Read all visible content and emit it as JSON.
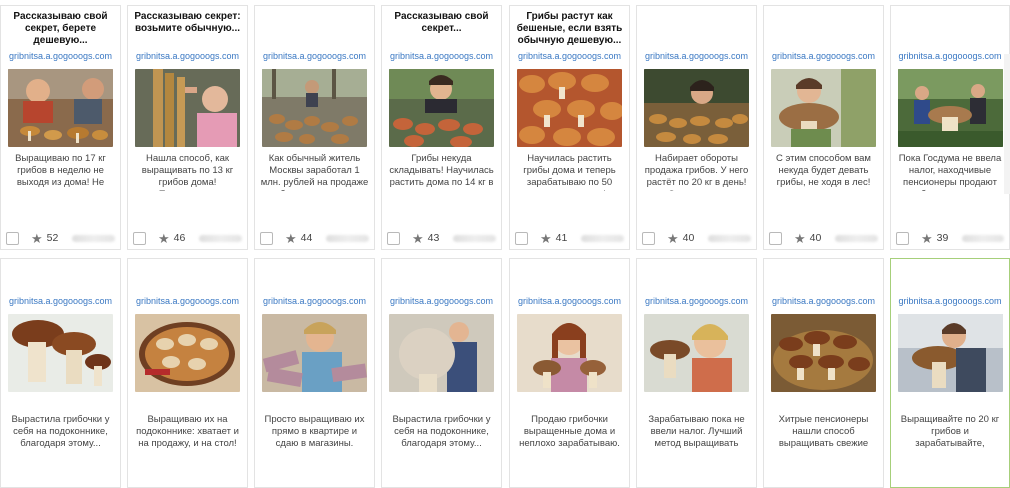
{
  "cards": [
    {
      "title": "Рассказываю свой секрет, берете дешевую...",
      "domain": "gribnitsa.a.gogooogs.com",
      "desc": "Выращиваю по 17 кг грибов в неделю не выходя из дома! Не знаем, куда девать",
      "rating": "52"
    },
    {
      "title": "Рассказываю секрет: возьмите обычную...",
      "domain": "gribnitsa.a.gogooogs.com",
      "desc": "Нашла способ, как выращивать по 13 кг грибов дома! Присоедится",
      "rating": "46"
    },
    {
      "title": "",
      "domain": "gribnitsa.a.gogooogs.com",
      "desc": "Как обычный житель Москвы заработал 1 млн. рублей на продаже грибов выращенных в",
      "rating": "44"
    },
    {
      "title": "Рассказываю свой секрет...",
      "domain": "gribnitsa.a.gogooogs.com",
      "desc": "Грибы некуда складывать! Научилась растить дома по 14 кг в неделю",
      "rating": "43"
    },
    {
      "title": "Грибы растут как бешеные, если взять обычную дешевую...",
      "domain": "gribnitsa.a.gogooogs.com",
      "desc": "Научилась растить грибы дома и теперь зарабатываю по 50 тысяч в неделю!",
      "rating": "41"
    },
    {
      "title": "",
      "domain": "gribnitsa.a.gogooogs.com",
      "desc": "Набирает обороты продажа грибов. У него растёт по 20 кг в день! Секрет в том",
      "rating": "40"
    },
    {
      "title": "",
      "domain": "gribnitsa.a.gogooogs.com",
      "desc": "С этим способом вам некуда будет девать грибы, не ходя в лес!",
      "rating": "40"
    },
    {
      "title": "",
      "domain": "gribnitsa.a.gogooogs.com",
      "desc": "Пока Госдума не ввела налог, находчивые пенсионеры продают грибы выращенные",
      "rating": "39"
    },
    {
      "title": "",
      "domain": "gribnitsa.a.gogooogs.com",
      "desc": "Вырастила грибочки у себя на подоконнике, благодаря этому..."
    },
    {
      "title": "",
      "domain": "gribnitsa.a.gogooogs.com",
      "desc": "Выращиваю их на подоконнике: хватает и на продажу, и на стол! Метод прост"
    },
    {
      "title": "",
      "domain": "gribnitsa.a.gogooogs.com",
      "desc": "Просто выращиваю их прямо в квартире и сдаю в магазины. Никаких походов в лес"
    },
    {
      "title": "",
      "domain": "gribnitsa.a.gogooogs.com",
      "desc": "Вырастила грибочки у себя на подоконнике, благодаря этому..."
    },
    {
      "title": "",
      "domain": "gribnitsa.a.gogooogs.com",
      "desc": "Продаю грибочки выращенные дома и неплохо зарабатываю. Мой метод"
    },
    {
      "title": "",
      "domain": "gribnitsa.a.gogooogs.com",
      "desc": "Зарабатываю пока не ввели налог. Лучший метод выращивать грибы дома по"
    },
    {
      "title": "",
      "domain": "gribnitsa.a.gogooogs.com",
      "desc": "Хитрые пенсионеры нашли способ выращивать свежие грибы у себя дома"
    },
    {
      "title": "",
      "domain": "gribnitsa.a.gogooogs.com",
      "desc": "Выращивайте по 20 кг грибов и зарабатывайте, благодаря этой"
    }
  ],
  "colors": {
    "link": "#3a78c3",
    "active_border": "#a6cf7a"
  }
}
